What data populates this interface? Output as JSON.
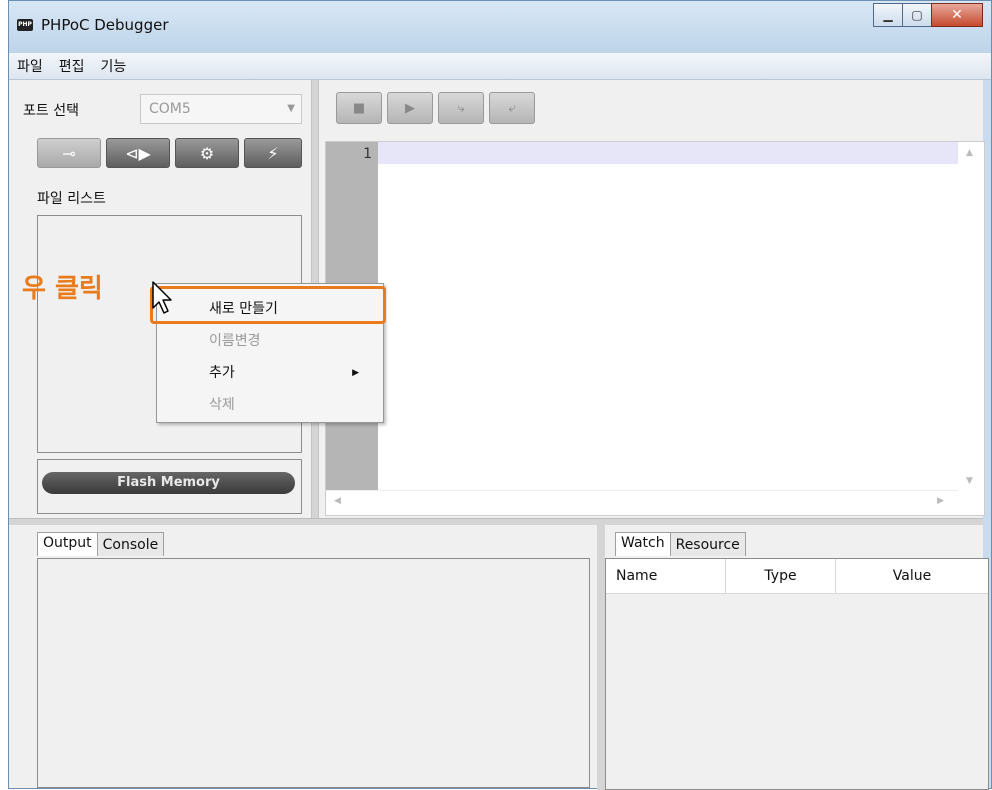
{
  "window": {
    "title": "PHPoC Debugger",
    "icon_text": "PHP"
  },
  "menu": [
    "파일",
    "편집",
    "기능"
  ],
  "left_panel": {
    "port_label": "포트 선택",
    "port_value": "COM5",
    "file_list_label": "파일 리스트",
    "flash_button": "Flash Memory"
  },
  "editor": {
    "line_numbers": [
      "1"
    ]
  },
  "output_panel": {
    "tabs": [
      "Output",
      "Console"
    ]
  },
  "watch_panel": {
    "tabs": [
      "Watch",
      "Resource"
    ],
    "columns": [
      "Name",
      "Type",
      "Value"
    ]
  },
  "context_menu": {
    "items": [
      {
        "label": "새로 만들기",
        "enabled": true
      },
      {
        "label": "이름변경",
        "enabled": false
      },
      {
        "label": "추가",
        "enabled": true,
        "submenu": true
      },
      {
        "label": "삭제",
        "enabled": false
      }
    ]
  },
  "annotation": {
    "text": "우 클릭",
    "color": "#ea7b1a"
  }
}
